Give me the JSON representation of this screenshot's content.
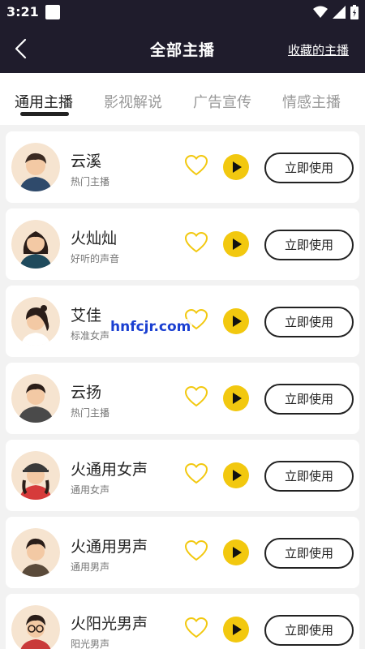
{
  "status_bar": {
    "time": "3:21"
  },
  "header": {
    "title": "全部主播",
    "favorites_link": "收藏的主播"
  },
  "tabs": [
    {
      "label": "通用主播",
      "active": true
    },
    {
      "label": "影视解说",
      "active": false
    },
    {
      "label": "广告宣传",
      "active": false
    },
    {
      "label": "情感主播",
      "active": false
    }
  ],
  "voices": [
    {
      "name": "云溪",
      "desc": "热门主播",
      "button": "立即使用"
    },
    {
      "name": "火灿灿",
      "desc": "好听的声音",
      "button": "立即使用"
    },
    {
      "name": "艾佳",
      "desc": "标准女声",
      "button": "立即使用"
    },
    {
      "name": "云扬",
      "desc": "热门主播",
      "button": "立即使用"
    },
    {
      "name": "火通用女声",
      "desc": "通用女声",
      "button": "立即使用"
    },
    {
      "name": "火通用男声",
      "desc": "通用男声",
      "button": "立即使用"
    },
    {
      "name": "火阳光男声",
      "desc": "阳光男声",
      "button": "立即使用"
    }
  ],
  "watermark": "hnfcjr.com",
  "colors": {
    "header_bg": "#1f1c2c",
    "accent_yellow": "#f2c80f",
    "heart_outline": "#f2c80f"
  }
}
